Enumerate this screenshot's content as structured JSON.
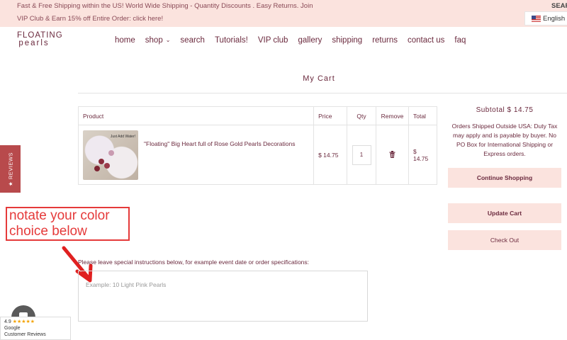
{
  "topbar": {
    "line1": "Fast & Free Shipping within the US! World Wide Shipping - Quantity Discounts . Easy Returns. Join",
    "line2": "VIP Club & Earn 15% off Entire Order: click here!",
    "search_label": "SEAR",
    "language": "English"
  },
  "logo": {
    "line1": "FLOATING",
    "line2": "pearls"
  },
  "nav": {
    "home": "home",
    "shop": "shop",
    "search": "search",
    "tutorials": "Tutorials!",
    "vip": "VIP club",
    "gallery": "gallery",
    "shipping": "shipping",
    "returns": "returns",
    "contact": "contact us",
    "faq": "faq"
  },
  "page_title": "My Cart",
  "table": {
    "headers": {
      "product": "Product",
      "price": "Price",
      "qty": "Qty",
      "remove": "Remove",
      "total": "Total"
    },
    "rows": [
      {
        "image_label": "Just Add Water!",
        "name": "\"Floating\" Big Heart full of Rose Gold Pearls Decorations",
        "price": "$ 14.75",
        "qty": "1",
        "total": "$ 14.75"
      }
    ]
  },
  "summary": {
    "subtotal": "Subtotal $ 14.75",
    "shipping_note": "Orders Shipped Outside USA: Duty Tax may apply and is payable by buyer. No PO Box for International Shipping or Express orders.",
    "continue_label": "Continue Shopping",
    "update_label": "Update Cart",
    "checkout_label": "Check Out"
  },
  "reviews_tab": "★ REVIEWS",
  "annotation": {
    "line1": "notate your color",
    "line2": "choice below"
  },
  "instructions": {
    "label": "Please leave special instructions below, for example event date or order specifications:",
    "placeholder": "Example: 10 Light Pink Pearls"
  },
  "google_badge": {
    "rating": "4.9",
    "stars": "★★★★★",
    "line1": "Google",
    "line2": "Customer Reviews"
  },
  "colors": {
    "accent_pink": "#fbe3de",
    "brand": "#6b2a3e",
    "annotation_red": "#e53a3a"
  }
}
